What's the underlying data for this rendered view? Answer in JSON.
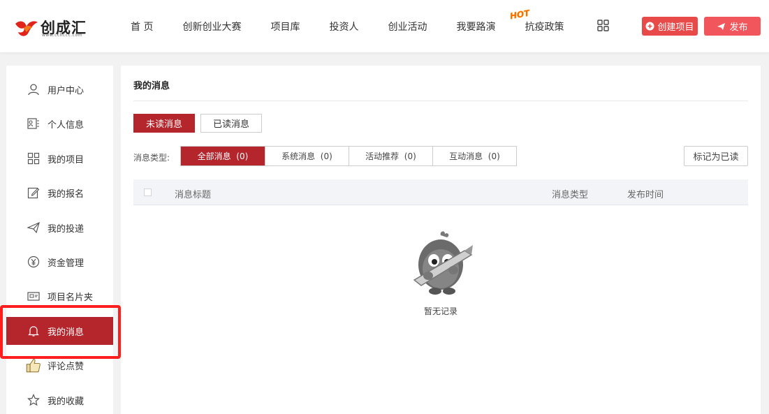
{
  "header": {
    "logo_text": "创成汇",
    "logo_sub": "www.cchccc.com",
    "nav": [
      "首 页",
      "创新创业大赛",
      "项目库",
      "投资人",
      "创业活动",
      "我要路演",
      "抗疫政策"
    ],
    "hot_badge": "HOT",
    "create_label": "创建项目",
    "publish_label": "发布"
  },
  "sidebar": {
    "items": [
      {
        "label": "用户中心",
        "icon": "user-icon"
      },
      {
        "label": "个人信息",
        "icon": "profile-card-icon"
      },
      {
        "label": "我的项目",
        "icon": "grid-icon"
      },
      {
        "label": "我的报名",
        "icon": "edit-icon"
      },
      {
        "label": "我的投递",
        "icon": "paper-plane-icon"
      },
      {
        "label": "资金管理",
        "icon": "yen-icon"
      },
      {
        "label": "项目名片夹",
        "icon": "card-holder-icon"
      },
      {
        "label": "我的消息",
        "icon": "bell-icon",
        "active": true
      },
      {
        "label": "评论点赞",
        "icon": "thumbs-up-icon"
      },
      {
        "label": "我的收藏",
        "icon": "star-icon"
      }
    ]
  },
  "main": {
    "title": "我的消息",
    "tab_unread": "未读消息",
    "tab_read": "已读消息",
    "type_label": "消息类型:",
    "segments": [
      "全部消息  (0)",
      "系统消息  (0)",
      "活动推荐  (0)",
      "互动消息  (0)"
    ],
    "mark_read": "标记为已读",
    "columns": [
      "消息标题",
      "消息类型",
      "发布时间"
    ],
    "empty_text": "暂无记录"
  },
  "colors": {
    "accent": "#b5252c",
    "create_btn": "#e84a4a",
    "publish_btn": "#f0565b",
    "highlight": "#ff1e1e"
  }
}
